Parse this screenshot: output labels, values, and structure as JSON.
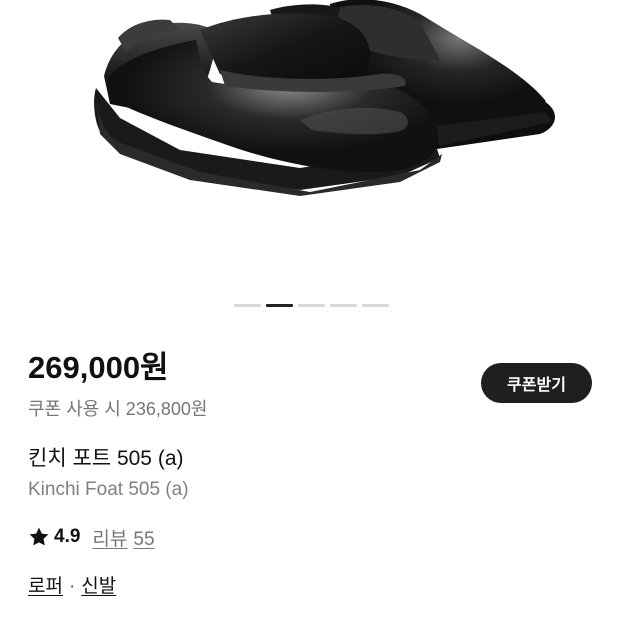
{
  "product": {
    "image_alt": "Kinchi Foat 505 (a) black leather loafers",
    "carousel": {
      "count": 5,
      "active_index": 1
    },
    "price": "269,000원",
    "coupon_button_label": "쿠폰받기",
    "coupon_price": "쿠폰 사용 시 236,800원",
    "name_ko": "킨치 포트 505 (a)",
    "name_en": "Kinchi Foat 505 (a)",
    "rating": "4.9",
    "review_label": "리뷰",
    "review_count": "55",
    "categories": [
      "로퍼",
      "신발"
    ],
    "category_separator": "·"
  },
  "icons": {
    "rating": "star-icon"
  },
  "colors": {
    "coupon_button_bg": "#1f1f1f",
    "secondary_text": "#777777",
    "indicator_active": "#222222",
    "indicator_inactive": "#d9d9d9"
  }
}
